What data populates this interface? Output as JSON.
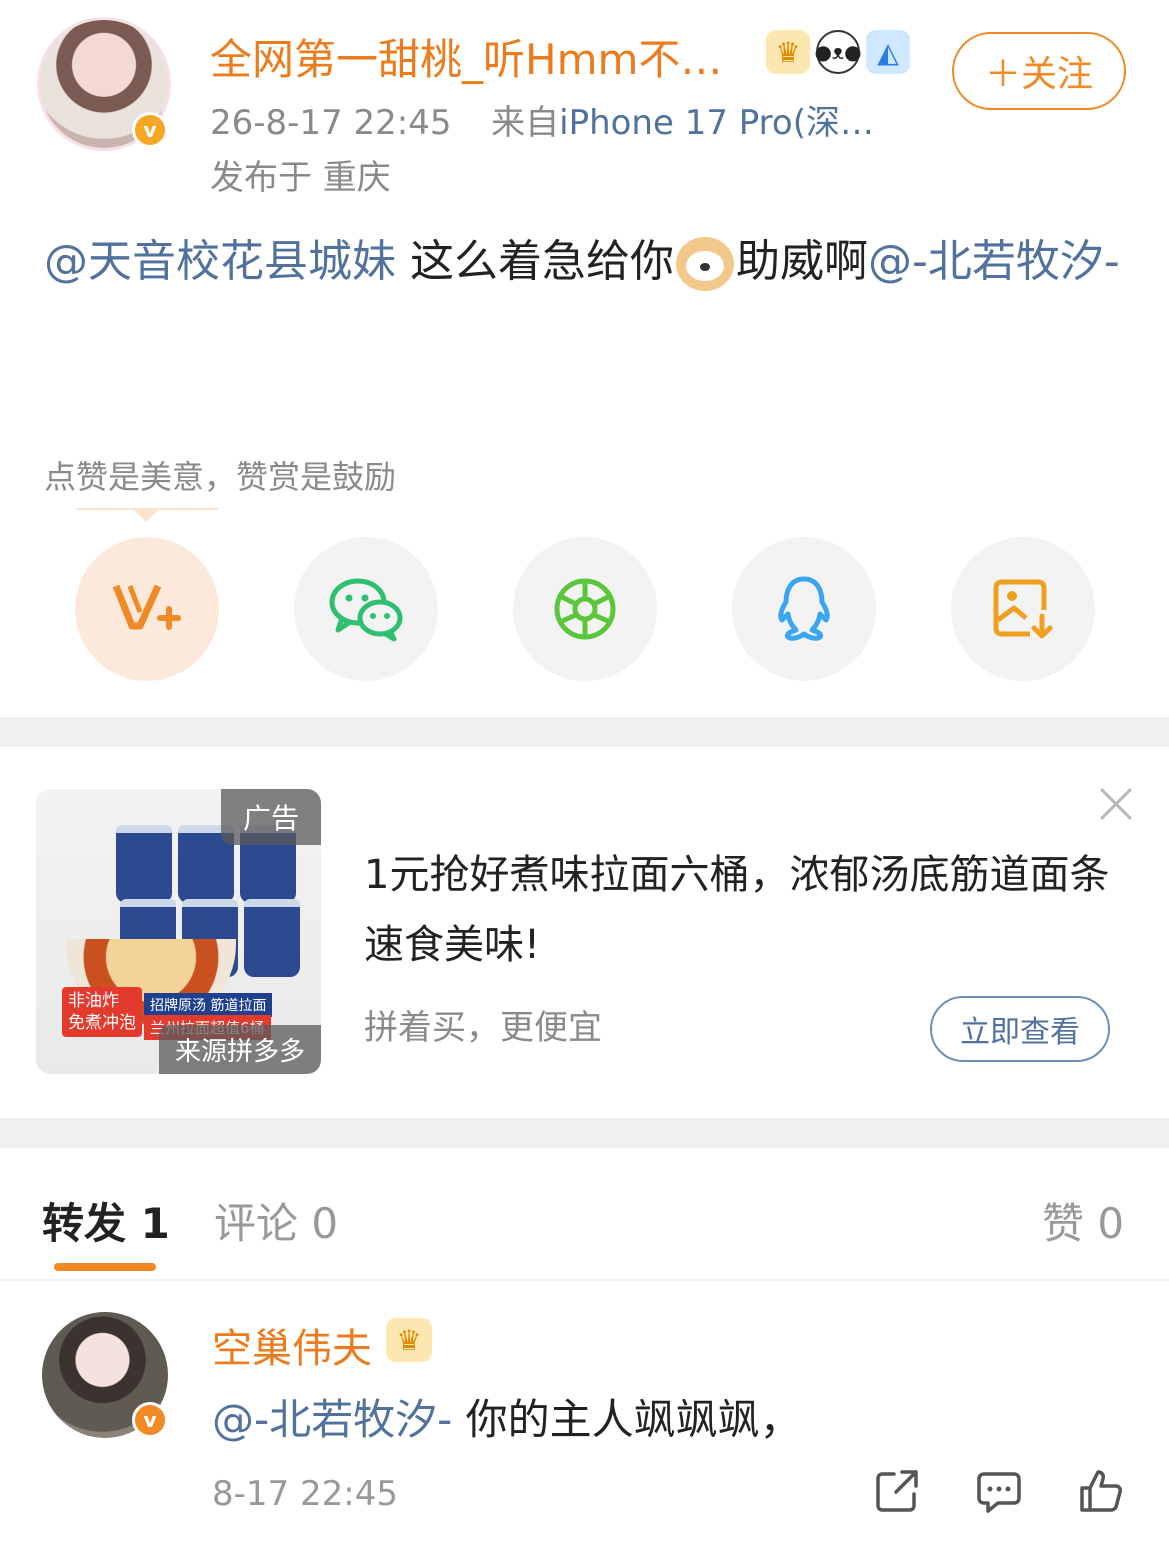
{
  "post": {
    "author": "全网第一甜桃_听Hmm不…",
    "time": "26-8-17 22:45",
    "source_prefix": "来自",
    "source_device": "iPhone 17 Pro(深…",
    "location": "发布于 重庆",
    "follow_label": "＋关注",
    "mention1": "@天音校花县城妹",
    "text_mid": " 这么着急给你",
    "text_after_emoji": "助威啊",
    "mention2": "@-北若牧汐-"
  },
  "reward": {
    "tip": "点赞是美意，赞赏是鼓励"
  },
  "share_icons": [
    {
      "name": "reward-v-plus-icon",
      "color": "#f08a24"
    },
    {
      "name": "wechat-icon",
      "color": "#2fbf71"
    },
    {
      "name": "moments-icon",
      "color": "#5ac73a"
    },
    {
      "name": "qq-icon",
      "color": "#3aa5f2"
    },
    {
      "name": "save-image-icon",
      "color": "#f0a020"
    }
  ],
  "ad": {
    "tag": "广告",
    "source": "来源拼多多",
    "strip1_line1": "非油炸",
    "strip1_line2": "免煮冲泡",
    "strip2": "招牌原汤 筋道拉面",
    "strip3": "兰州拉面超值6桶",
    "title": "1元抢好煮味拉面六桶，浓郁汤底筋道面条速食美味!",
    "subtitle": "拼着买，更便宜",
    "cta": "立即查看"
  },
  "tabs": {
    "repost": "转发 1",
    "comment": "评论 0",
    "like": "赞 0"
  },
  "repost_item": {
    "author": "空巢伟夫",
    "mention": "@-北若牧汐-",
    "text": " 你的主人飒飒飒，",
    "time": "8-17 22:45"
  },
  "colors": {
    "brand_orange": "#f08a24",
    "link_blue": "#52729e"
  }
}
